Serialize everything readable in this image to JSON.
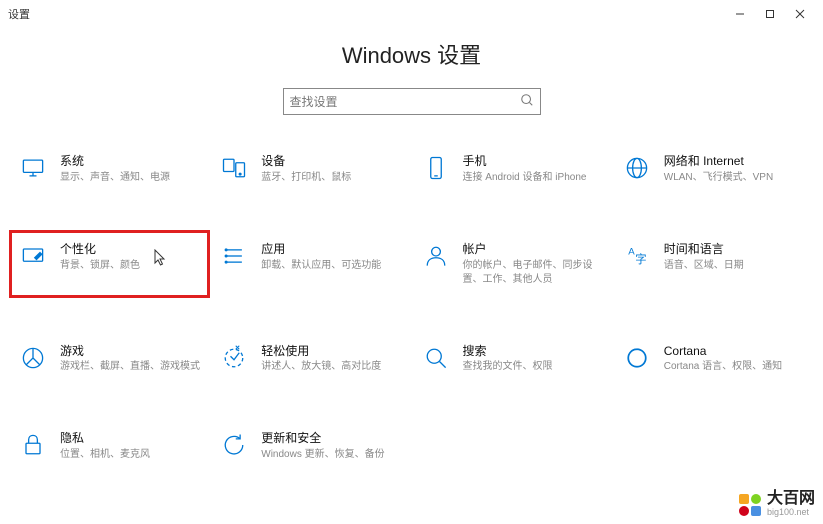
{
  "window": {
    "title": "设置"
  },
  "header": {
    "title": "Windows 设置"
  },
  "search": {
    "placeholder": "查找设置"
  },
  "tiles": [
    {
      "id": "system",
      "title": "系统",
      "desc": "显示、声音、通知、电源"
    },
    {
      "id": "devices",
      "title": "设备",
      "desc": "蓝牙、打印机、鼠标"
    },
    {
      "id": "phone",
      "title": "手机",
      "desc": "连接 Android 设备和 iPhone"
    },
    {
      "id": "network",
      "title": "网络和 Internet",
      "desc": "WLAN、飞行模式、VPN"
    },
    {
      "id": "personalize",
      "title": "个性化",
      "desc": "背景、锁屏、颜色",
      "highlight": true
    },
    {
      "id": "apps",
      "title": "应用",
      "desc": "卸载、默认应用、可选功能"
    },
    {
      "id": "accounts",
      "title": "帐户",
      "desc": "你的帐户、电子邮件、同步设置、工作、其他人员"
    },
    {
      "id": "time",
      "title": "时间和语言",
      "desc": "语音、区域、日期"
    },
    {
      "id": "gaming",
      "title": "游戏",
      "desc": "游戏栏、截屏、直播、游戏模式"
    },
    {
      "id": "ease",
      "title": "轻松使用",
      "desc": "讲述人、放大镜、高对比度"
    },
    {
      "id": "search",
      "title": "搜索",
      "desc": "查找我的文件、权限"
    },
    {
      "id": "cortana",
      "title": "Cortana",
      "desc": "Cortana 语言、权限、通知"
    },
    {
      "id": "privacy",
      "title": "隐私",
      "desc": "位置、相机、麦克风"
    },
    {
      "id": "update",
      "title": "更新和安全",
      "desc": "Windows 更新、恢复、备份"
    }
  ],
  "watermark": {
    "main": "大百网",
    "sub": "big100.net"
  }
}
